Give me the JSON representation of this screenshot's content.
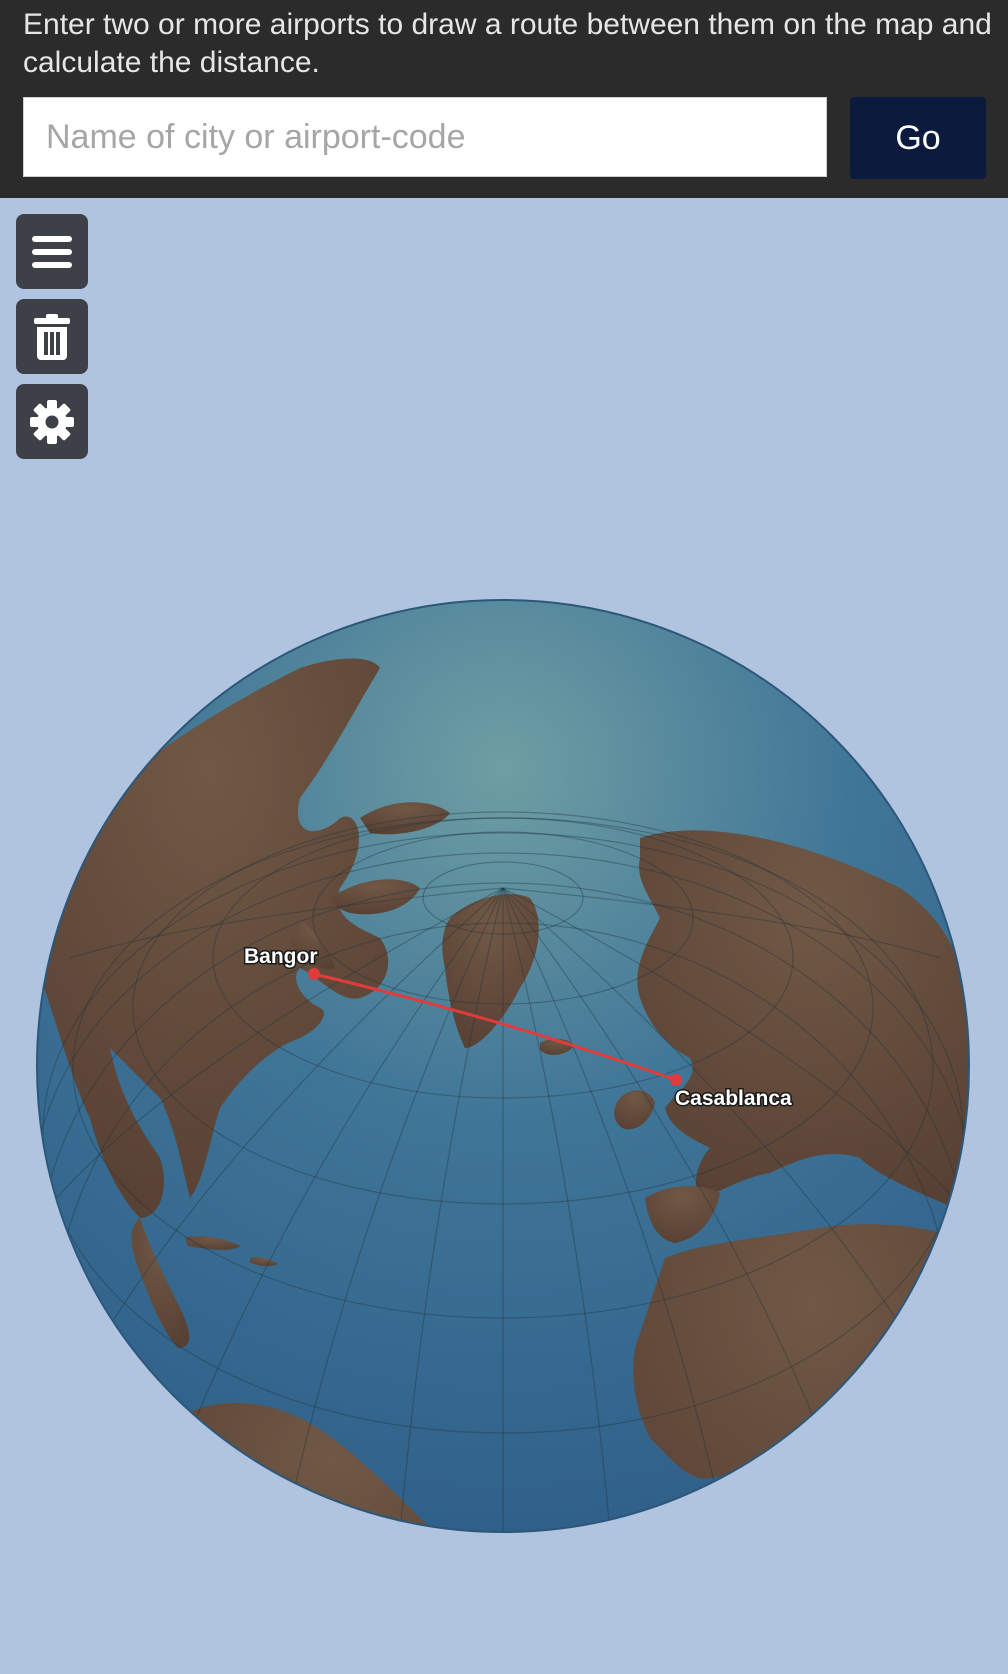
{
  "header": {
    "intro_text": "Enter two or more airports to draw a route between them on the map and calculate the distance.",
    "search_placeholder": "Name of city or airport-code",
    "search_value": "",
    "go_label": "Go"
  },
  "toolbar": [
    {
      "name": "menu-button",
      "icon": "hamburger-icon"
    },
    {
      "name": "delete-button",
      "icon": "trash-icon"
    },
    {
      "name": "settings-button",
      "icon": "gear-icon"
    }
  ],
  "route": {
    "from": {
      "label": "Bangor"
    },
    "to": {
      "label": "Casablanca"
    },
    "line_color": "#e03c3c"
  },
  "colors": {
    "ocean": "#35678f",
    "land": "#5e4637",
    "header_bg": "#2b2b2b",
    "go_button": "#0c1a3d",
    "page_bg": "#b0c4df"
  }
}
